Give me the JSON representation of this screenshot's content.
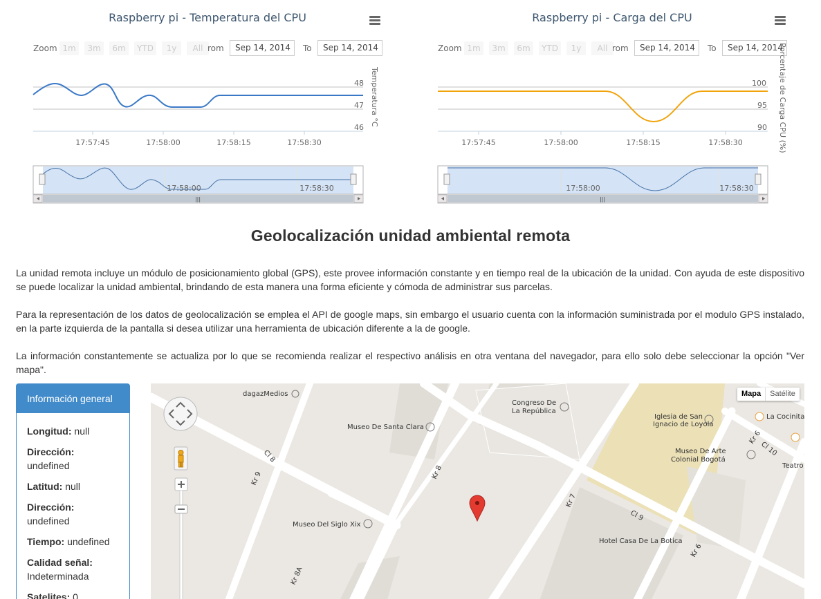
{
  "charts": [
    {
      "title": "Raspberry pi - Temperatura del CPU",
      "zoom_label": "Zoom",
      "zoom_buttons": [
        "1m",
        "3m",
        "6m",
        "YTD",
        "1y",
        "All"
      ],
      "from_label": "rom",
      "to_label": "To",
      "from_value": "Sep 14, 2014",
      "to_value": "Sep 14, 2014",
      "y_axis_title": "Temperatura °C",
      "y_ticks": [
        "48",
        "47",
        "46"
      ],
      "x_ticks": [
        "17:57:45",
        "17:58:00",
        "17:58:15",
        "17:58:30"
      ],
      "navigator_ticks": [
        "17:58:00",
        "17:58:30"
      ],
      "line_color": "#3a78c6"
    },
    {
      "title": "Raspberry pi - Carga del CPU",
      "zoom_label": "Zoom",
      "zoom_buttons": [
        "1m",
        "3m",
        "6m",
        "YTD",
        "1y",
        "All"
      ],
      "from_label": "rom",
      "to_label": "To",
      "from_value": "Sep 14, 2014",
      "to_value": "Sep 14, 2014",
      "y_axis_title": "Porcentaje de Carga CPU (%)",
      "y_ticks": [
        "100",
        "95",
        "90"
      ],
      "x_ticks": [
        "17:57:45",
        "17:58:00",
        "17:58:15",
        "17:58:30"
      ],
      "navigator_ticks": [
        "17:58:00",
        "17:58:30"
      ],
      "line_color": "#f0a30a"
    }
  ],
  "section": {
    "title": "Geolocalización unidad ambiental remota",
    "paragraphs": [
      "La unidad remota incluye un módulo de posicionamiento global (GPS), este provee información constante y en tiempo real de la ubicación de la unidad. Con ayuda de este dispositivo se puede localizar la unidad ambiental, brindando de esta manera una forma eficiente y cómoda de administrar sus parcelas.",
      "Para la representación de los datos de geolocalización se emplea el API de google maps, sin embargo el usuario cuenta con la información suministrada por el modulo GPS instalado, en la parte izquierda de la pantalla si desea utilizar una herramienta de ubicación diferente a la de google.",
      "La información constantemente se actualiza por lo que se recomienda realizar el respectivo análisis en otra ventana del navegador, para ello solo debe seleccionar la opción \"Ver mapa\"."
    ]
  },
  "info": {
    "heading": "Información general",
    "rows": [
      {
        "label": "Longitud:",
        "value": "null"
      },
      {
        "label": "Dirección:",
        "value": "undefined"
      },
      {
        "label": "Latitud:",
        "value": "null"
      },
      {
        "label": "Dirección:",
        "value": "undefined"
      },
      {
        "label": "Tiempo:",
        "value": "undefined"
      },
      {
        "label": "Calidad señal:",
        "value": "Indeterminada"
      },
      {
        "label": "Satelites:",
        "value": "0"
      }
    ]
  },
  "map": {
    "type_buttons": [
      "Mapa",
      "Satélite"
    ],
    "labels": {
      "dagaz": "dagazMedios",
      "congreso": "Congreso De\nLa República",
      "santa_clara": "Museo De Santa Clara",
      "iglesia": "Iglesia de San\nIgnacio de Loyola",
      "cocinita": "La Cocinita",
      "museo_arte": "Museo De Arte\nColonial Bogotá",
      "teatro": "Teatro",
      "siglo": "Museo Del Siglo Xix",
      "hotel": "Hotel Casa De La Botica",
      "cl8": "Cl 8",
      "kr9": "Kr 9",
      "kr8": "Kr 8",
      "kr8a": "Kr 8A",
      "kr7": "Kr 7",
      "cl9": "Cl 9",
      "kr6a": "Kr 6",
      "kr6b": "Kr 6",
      "cl10": "Cl 10"
    }
  }
}
